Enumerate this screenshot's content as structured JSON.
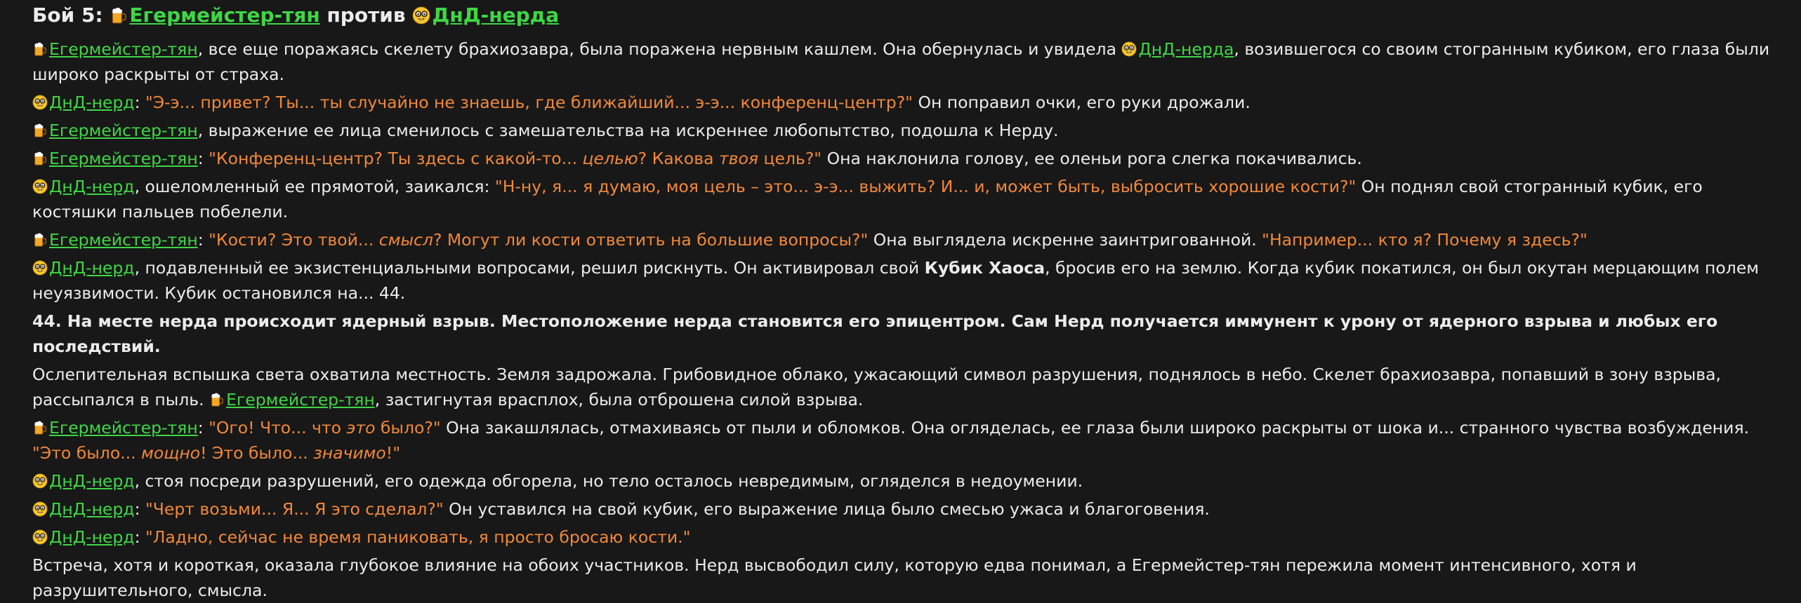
{
  "title": {
    "prefix": "Бой 5:",
    "char1": "Егермейстер-тян",
    "vs": "против",
    "char2": "ДнД-нерда"
  },
  "names": {
    "jager": "Егермейстер-тян",
    "nerd": "ДнД-нерда",
    "nerd_nom": "ДнД-нерд"
  },
  "icons": {
    "jager": "beer-mug-icon",
    "nerd": "nerd-face-icon"
  },
  "colors": {
    "background": "#181818",
    "text": "#ececec",
    "name_link": "#3fd645",
    "quote": "#f2883a"
  },
  "p1": {
    "t1": ", все еще поражаясь скелету брахиозавра, была поражена нервным кашлем. Она обернулась и увидела ",
    "t2": ", возившегося со своим стогранным кубиком, его глаза были широко раскрыты от страха."
  },
  "p2": {
    "sep": ": ",
    "q1": "\"Э-э... привет? Ты... ты случайно не знаешь, где ближайший... э-э... конференц-центр?\"",
    "t1": " Он поправил очки, его руки дрожали."
  },
  "p3": {
    "t1": ", выражение ее лица сменилось с замешательства на искреннее любопытство, подошла к Нерду."
  },
  "p4": {
    "sep": ": ",
    "q1a": "\"Конференц-центр? Ты здесь с какой-то... ",
    "q1b": "целью",
    "q1c": "? Какова ",
    "q1d": "твоя",
    "q1e": " цель?\"",
    "t1": " Она наклонила голову, ее оленьи рога слегка покачивались."
  },
  "p5": {
    "t1": ", ошеломленный ее прямотой, заикался: ",
    "q1": "\"Н-ну, я... я думаю, моя цель – это... э-э... выжить? И... и, может быть, выбросить хорошие кости?\"",
    "t2": " Он поднял свой стогранный кубик, его костяшки пальцев побелели."
  },
  "p6": {
    "sep": ": ",
    "q1a": "\"Кости? Это твой... ",
    "q1b": "смысл",
    "q1c": "? Могут ли кости ответить на большие вопросы?\"",
    "t1": " Она выглядела искренне заинтригованной. ",
    "q2": "\"Например... кто я? Почему я здесь?\""
  },
  "p7": {
    "t1": ", подавленный ее экзистенциальными вопросами, решил рискнуть. Он активировал свой ",
    "b1": "Кубик Хаоса",
    "t2": ", бросив его на землю. Когда кубик покатился, он был окутан мерцающим полем неуязвимости. Кубик остановился на... 44."
  },
  "p8": {
    "b1": "44. На месте нерда происходит ядерный взрыв. Местоположение нерда становится его эпицентром. Сам Нерд получается иммунент к урону от ядерного взрыва и любых его последствий."
  },
  "p9": {
    "t1": "Ослепительная вспышка света охватила местность. Земля задрожала. Грибовидное облако, ужасающий символ разрушения, поднялось в небо. Скелет брахиозавра, попавший в зону взрыва, рассыпался в пыль. ",
    "t2": ", застигнутая врасплох, была отброшена силой взрыва."
  },
  "p10": {
    "sep": ": ",
    "q1a": "\"Ого! Что... что ",
    "q1b": "это",
    "q1c": " было?\"",
    "t1": " Она закашлялась, отмахиваясь от пыли и обломков. Она огляделась, ее глаза были широко раскрыты от шока и... странного чувства возбуждения. ",
    "q2a": "\"Это было... ",
    "q2b": "мощно",
    "q2c": "! Это было... ",
    "q2d": "значимо",
    "q2e": "!\""
  },
  "p11": {
    "t1": ", стоя посреди разрушений, его одежда обгорела, но тело осталось невредимым, огляделся в недоумении."
  },
  "p12": {
    "sep": ": ",
    "q1": "\"Черт возьми... Я... Я это сделал?\"",
    "t1": " Он уставился на свой кубик, его выражение лица было смесью ужаса и благоговения."
  },
  "p13": {
    "sep": ": ",
    "q1": "\"Ладно, сейчас не время паниковать, я просто бросаю кости.\""
  },
  "p14": {
    "t1": "Встреча, хотя и короткая, оказала глубокое влияние на обоих участников. Нерд высвободил силу, которую едва понимал, а Егермейстер-тян пережила момент интенсивного, хотя и разрушительного, смысла."
  }
}
